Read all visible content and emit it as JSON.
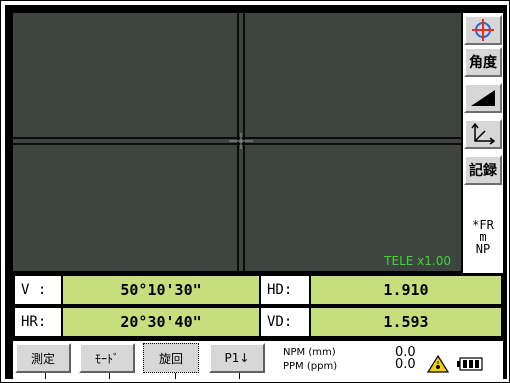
{
  "viewer": {
    "zoom_label": "TELE x1.00"
  },
  "side": {
    "buttons": [
      {
        "icon": "crosshair-target-icon"
      },
      {
        "label": "角度"
      },
      {
        "icon": "slope-icon"
      },
      {
        "icon": "coordinate-axis-icon"
      },
      {
        "label": "記録"
      }
    ],
    "status_lines": [
      "*FR",
      "m",
      "NP"
    ]
  },
  "measurements": {
    "v": {
      "label": "V :",
      "value": "50°10'30\""
    },
    "hr": {
      "label": "HR:",
      "value": "20°30'40\""
    },
    "hd": {
      "label": "HD:",
      "value": "1.910"
    },
    "vd": {
      "label": "VD:",
      "value": "1.593"
    }
  },
  "softkeys": [
    {
      "label": "測定"
    },
    {
      "label": "ﾓｰﾄﾞ"
    },
    {
      "label": "旋回"
    },
    {
      "label": "P1↓"
    }
  ],
  "status": {
    "npm_label": "NPM (mm)",
    "ppm_label": "PPM (ppm)",
    "npm_value": "0.0",
    "ppm_value": "0.0",
    "laser_icon": "laser-warning-icon",
    "battery_icon": "battery-icon"
  },
  "colors": {
    "value_bg": "#c6de7c",
    "viewer_bg": "#3e4440",
    "tele_text": "#41d43a"
  }
}
